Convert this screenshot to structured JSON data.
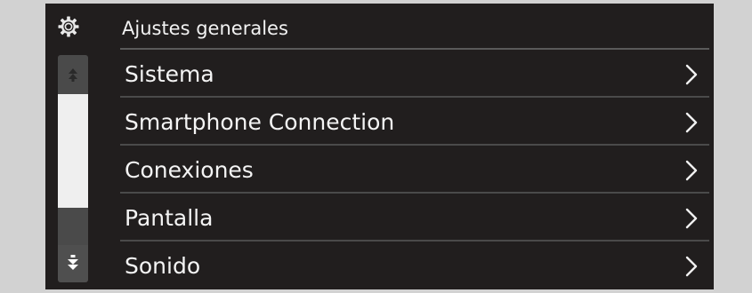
{
  "header": {
    "icon": "gear-icon",
    "title": "Ajustes generales"
  },
  "scrollbar": {
    "up_icon": "scroll-up-arrows-icon",
    "down_icon": "scroll-down-arrows-icon"
  },
  "menu": {
    "items": [
      {
        "label": "Sistema",
        "icon": "chevron-right-icon"
      },
      {
        "label": "Smartphone Connection",
        "icon": "chevron-right-icon"
      },
      {
        "label": "Conexiones",
        "icon": "chevron-right-icon"
      },
      {
        "label": "Pantalla",
        "icon": "chevron-right-icon"
      },
      {
        "label": "Sonido",
        "icon": "chevron-right-icon"
      }
    ]
  },
  "colors": {
    "screen_background": "#211e1e",
    "bezel": "#d2d2d2",
    "text": "#f4f4f4",
    "divider": "#4a4a4a"
  }
}
